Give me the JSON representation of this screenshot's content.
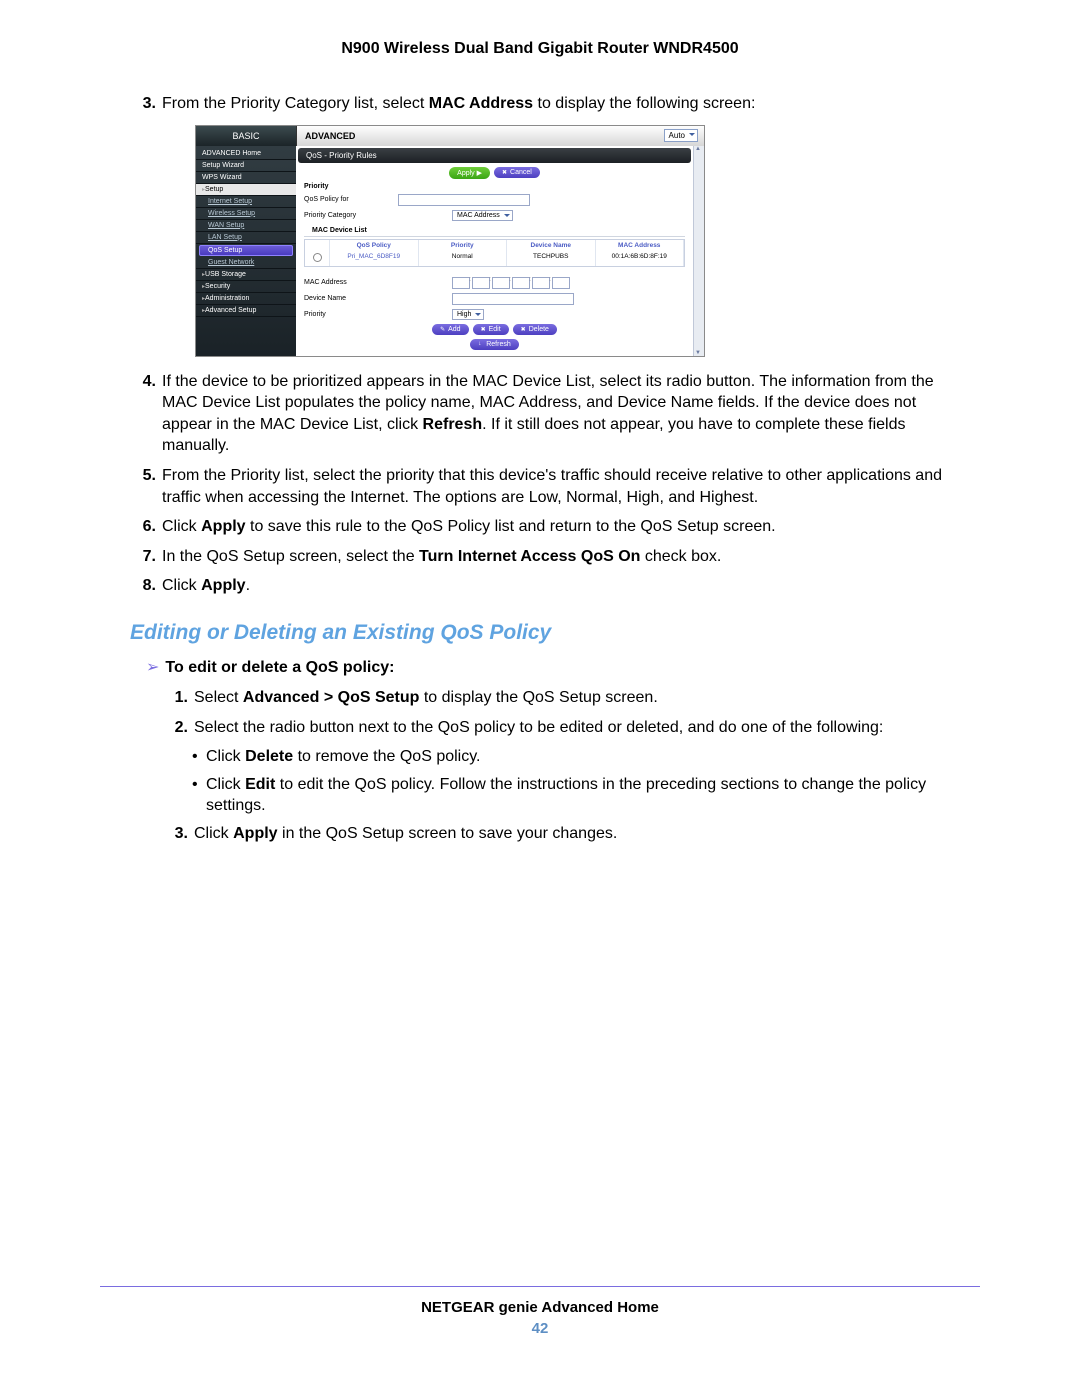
{
  "header": "N900 Wireless Dual Band Gigabit Router WNDR4500",
  "step3": {
    "num": "3.",
    "pre": "From the Priority Category list, select ",
    "bold": "MAC Address",
    "post": " to display the following screen:"
  },
  "ui": {
    "tabs": {
      "basic": "BASIC",
      "advanced": "ADVANCED",
      "auto": "Auto"
    },
    "nav": {
      "adv_home": "ADVANCED Home",
      "setup_wiz": "Setup Wizard",
      "wps_wiz": "WPS Wizard",
      "setup": "Setup",
      "internet": "Internet Setup",
      "wireless": "Wireless Setup",
      "wan": "WAN Setup",
      "lan": "LAN Setup",
      "qos": "QoS Setup",
      "guest": "Guest Network",
      "usb": "USB Storage",
      "sec": "Security",
      "admin": "Administration",
      "advsetup": "Advanced Setup"
    },
    "pane": {
      "title": "QoS - Priority Rules",
      "apply": "Apply ▶",
      "cancel": "Cancel",
      "priority_lbl": "Priority",
      "policy_for_lbl": "QoS Policy for",
      "cat_lbl": "Priority Category",
      "cat_val": "MAC Address",
      "macdev_hdr": "MAC Device List",
      "table": {
        "h1": "QoS Policy",
        "h2": "Priority",
        "h3": "Device Name",
        "h4": "MAC Address",
        "r1": "Pri_MAC_6D8F19",
        "r2": "Normal",
        "r3": "TECHPUBS",
        "r4": "00:1A:6B:6D:8F:19"
      },
      "mac_lbl": "MAC Address",
      "devname_lbl": "Device Name",
      "prio2_lbl": "Priority",
      "prio2_val": "High",
      "btn_add": "Add",
      "btn_edit": "Edit",
      "btn_del": "Delete",
      "btn_ref": "Refresh"
    }
  },
  "step4": {
    "num": "4.",
    "t1": "If the device to be prioritized appears in the MAC Device List, select its radio button. The information from the MAC Device List populates the policy name, MAC Address, and Device Name fields. If the device does not appear in the MAC Device List, click ",
    "b": "Refresh",
    "t2": ". If it still does not appear, you have to complete these fields manually."
  },
  "step5": {
    "num": "5.",
    "t": "From the Priority list, select the priority that this device's traffic should receive relative to other applications and traffic when accessing the Internet. The options are Low, Normal, High, and Highest."
  },
  "step6": {
    "num": "6.",
    "t1": "Click ",
    "b": "Apply",
    "t2": " to save this rule to the QoS Policy list and return to the QoS Setup screen."
  },
  "step7": {
    "num": "7.",
    "t1": "In the QoS Setup screen, select the ",
    "b": "Turn Internet Access QoS On",
    "t2": " check box."
  },
  "step8": {
    "num": "8.",
    "t1": "Click ",
    "b": "Apply",
    "t2": "."
  },
  "h2": "Editing or Deleting an Existing QoS Policy",
  "subh": "To edit or delete a QoS policy:",
  "e1": {
    "num": "1.",
    "t1": "Select ",
    "b": "Advanced > QoS Setup",
    "t2": " to display the QoS Setup screen."
  },
  "e2": {
    "num": "2.",
    "t": "Select the radio button next to the QoS policy to be edited or deleted, and do one of the following:"
  },
  "bul1": {
    "t1": "Click ",
    "b": "Delete",
    "t2": " to remove the QoS policy."
  },
  "bul2": {
    "t1": "Click ",
    "b": "Edit",
    "t2": " to edit the QoS policy. Follow the instructions in the preceding sections to change the policy settings."
  },
  "e3": {
    "num": "3.",
    "t1": "Click ",
    "b": "Apply",
    "t2": " in the QoS Setup screen to save your changes."
  },
  "footer": {
    "title": "NETGEAR genie Advanced Home",
    "page": "42"
  }
}
